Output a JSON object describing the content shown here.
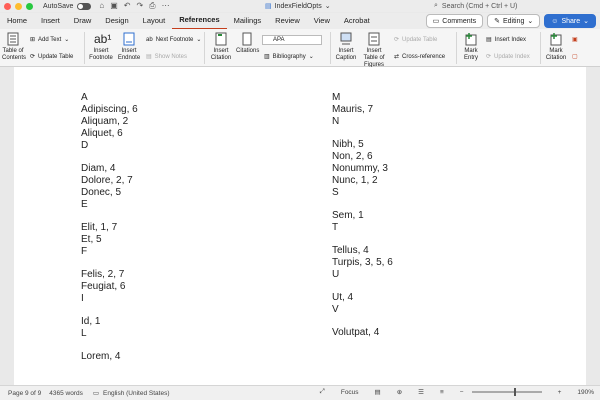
{
  "titlebar": {
    "autosave_label": "AutoSave",
    "doc_title": "IndexFieldOpts",
    "search_placeholder": "Search (Cmd + Ctrl + U)"
  },
  "tabs": [
    "Home",
    "Insert",
    "Draw",
    "Design",
    "Layout",
    "References",
    "Mailings",
    "Review",
    "View",
    "Acrobat"
  ],
  "active_tab": "References",
  "header_buttons": {
    "comments": "Comments",
    "editing": "Editing",
    "share": "Share"
  },
  "ribbon": {
    "toc": "Table of Contents",
    "add_text": "Add Text",
    "update_table": "Update Table",
    "insert_footnote": "Insert Footnote",
    "insert_endnote": "Insert Endnote",
    "next_footnote": "Next Footnote",
    "show_notes": "Show Notes",
    "insert_citation": "Insert Citation",
    "citations": "Citations",
    "style_value": "APA",
    "bibliography": "Bibliography",
    "insert_caption": "Insert Caption",
    "insert_tof": "Insert Table of Figures",
    "update_table2": "Update Table",
    "cross_reference": "Cross-reference",
    "mark_entry": "Mark Entry",
    "insert_index": "Insert Index",
    "update_index": "Update Index",
    "mark_citation": "Mark Citation"
  },
  "left_col": [
    {
      "t": "A",
      "h": true
    },
    {
      "t": "Adipiscing, 6"
    },
    {
      "t": "Aliquam, 2"
    },
    {
      "t": "Aliquet, 6"
    },
    {
      "t": "D"
    },
    {
      "t": "Diam, 4",
      "h": true
    },
    {
      "t": "Dolore, 2, 7"
    },
    {
      "t": "Donec, 5"
    },
    {
      "t": "E"
    },
    {
      "t": "Elit, 1, 7",
      "h": true
    },
    {
      "t": "Et, 5"
    },
    {
      "t": "F"
    },
    {
      "t": "Felis, 2, 7",
      "h": true
    },
    {
      "t": "Feugiat, 6"
    },
    {
      "t": "I"
    },
    {
      "t": "Id, 1",
      "h": true
    },
    {
      "t": "L"
    },
    {
      "t": "Lorem, 4",
      "h": true
    }
  ],
  "right_col": [
    {
      "t": "M",
      "h": true
    },
    {
      "t": "Mauris, 7"
    },
    {
      "t": "N"
    },
    {
      "t": "Nibh, 5",
      "h": true
    },
    {
      "t": "Non, 2, 6"
    },
    {
      "t": "Nonummy, 3"
    },
    {
      "t": "Nunc, 1, 2"
    },
    {
      "t": "S"
    },
    {
      "t": "Sem, 1",
      "h": true
    },
    {
      "t": "T"
    },
    {
      "t": "Tellus, 4",
      "h": true
    },
    {
      "t": "Turpis, 3, 5, 6"
    },
    {
      "t": "U"
    },
    {
      "t": "Ut, 4",
      "h": true
    },
    {
      "t": "V"
    },
    {
      "t": "Volutpat, 4",
      "h": true
    }
  ],
  "status": {
    "page": "Page 9 of 9",
    "words": "4365 words",
    "language": "English (United States)",
    "focus": "Focus",
    "zoom": "190%"
  }
}
